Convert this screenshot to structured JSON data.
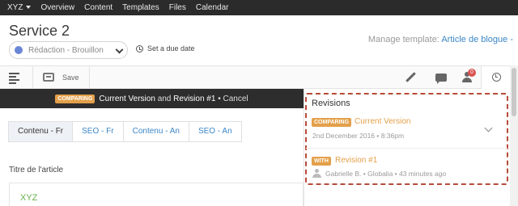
{
  "topnav": {
    "brand": "XYZ",
    "items": [
      "Overview",
      "Content",
      "Templates",
      "Files",
      "Calendar"
    ]
  },
  "header": {
    "title": "Service 2",
    "status": "Rédaction - Brouillon",
    "status_color": "#6a86d6",
    "due_date": "Set a due date",
    "manage_label": "Manage template:",
    "manage_link": "Article de blogue -"
  },
  "toolbar": {
    "save_label": "Save",
    "notification_count": "0"
  },
  "compare_bar": {
    "tag": "COMPARING",
    "current": "Current Version",
    "and": "and",
    "revision": "Revision #1",
    "cancel": "• Cancel"
  },
  "tabs": [
    "Contenu - Fr",
    "SEO - Fr",
    "Contenu - An",
    "SEO - An"
  ],
  "field": {
    "label": "Titre de l'article",
    "value": "XYZ"
  },
  "revisions": {
    "title": "Revisions",
    "items": [
      {
        "tag": "COMPARING",
        "name": "Current Version",
        "meta": "2nd December 2016 • 8:36pm"
      },
      {
        "tag": "WITH",
        "name": "Revision #1",
        "meta": "Gabrielle B. • Globalia • 43 minutes ago"
      }
    ]
  },
  "colors": {
    "accent": "#e3a04a",
    "link": "#3b86c6",
    "highlight_outline": "#b84a3a"
  }
}
